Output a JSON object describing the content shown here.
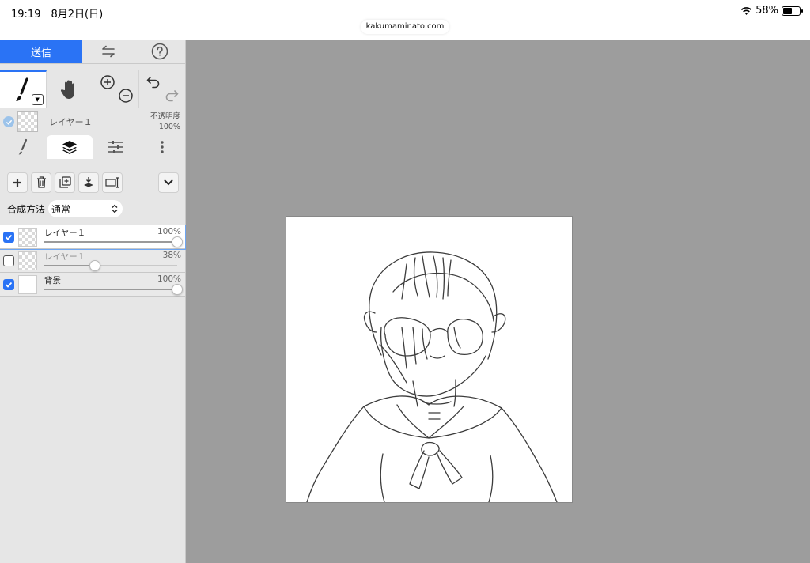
{
  "status": {
    "time": "19:19　8月2日(日)",
    "url": "kakumaminato.com",
    "battery": "58%",
    "battery_level": 0.58
  },
  "topbar": {
    "send_label": "送信"
  },
  "current_layer": {
    "name": "レイヤー１",
    "opacity_title": "不透明度",
    "opacity_value": "100%"
  },
  "blend": {
    "label": "合成方法",
    "value": "通常"
  },
  "layers": [
    {
      "name": "レイヤー１",
      "opacity": "100%",
      "opacity_value": 1.0,
      "checked": true,
      "selected": true,
      "struck": false
    },
    {
      "name": "レイヤー１",
      "opacity": "38%",
      "opacity_value": 0.38,
      "checked": false,
      "selected": false,
      "struck": true
    },
    {
      "name": "背景",
      "opacity": "100%",
      "opacity_value": 1.0,
      "checked": true,
      "selected": false,
      "struck": false
    }
  ],
  "icons": {
    "topbar": [
      "swap-arrows-icon",
      "help-icon"
    ],
    "tools": [
      "brush-tool-icon",
      "hand-icon",
      "zoom-in-icon",
      "zoom-out-icon",
      "undo-icon",
      "redo-icon"
    ],
    "tabs": [
      "brush-tab-icon",
      "layers-tab-icon",
      "adjustments-tab-icon",
      "more-vertical-icon"
    ],
    "actions": [
      "add-layer-icon",
      "delete-layer-icon",
      "duplicate-layer-icon",
      "merge-down-icon",
      "rename-layer-icon",
      "chevron-down-icon"
    ]
  },
  "colors": {
    "accent": "#2a73f5",
    "panel": "#e6e6e6",
    "workspace": "#9d9d9d"
  }
}
